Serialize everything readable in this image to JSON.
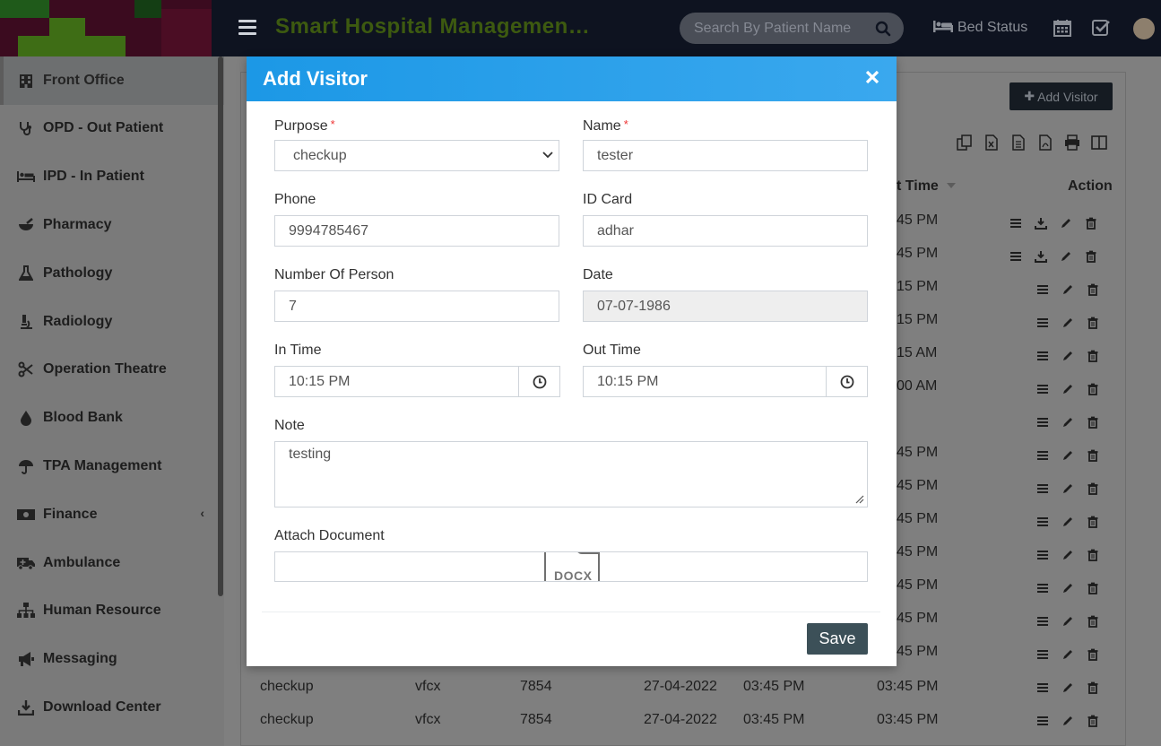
{
  "app": {
    "title": "Smart Hospital Managemen…",
    "search_placeholder": "Search By Patient Name",
    "bed_status": "Bed Status",
    "header_bg": "#0e1320",
    "title_color": "#3d5a10"
  },
  "sidebar": {
    "items": [
      {
        "label": "Front Office",
        "icon": "building-icon"
      },
      {
        "label": "OPD - Out Patient",
        "icon": "stethoscope-icon"
      },
      {
        "label": "IPD - In Patient",
        "icon": "bed-icon"
      },
      {
        "label": "Pharmacy",
        "icon": "mortar-pestle-icon"
      },
      {
        "label": "Pathology",
        "icon": "flask-icon"
      },
      {
        "label": "Radiology",
        "icon": "microscope-icon"
      },
      {
        "label": "Operation Theatre",
        "icon": "scissors-icon"
      },
      {
        "label": "Blood Bank",
        "icon": "tint-icon"
      },
      {
        "label": "TPA Management",
        "icon": "umbrella-icon"
      },
      {
        "label": "Finance",
        "icon": "money-icon"
      },
      {
        "label": "Ambulance",
        "icon": "ambulance-icon"
      },
      {
        "label": "Human Resource",
        "icon": "sitemap-icon"
      },
      {
        "label": "Messaging",
        "icon": "bullhorn-icon"
      },
      {
        "label": "Download Center",
        "icon": "download-icon"
      }
    ]
  },
  "background": {
    "add_visitor_label": "Add Visitor",
    "out_time_header": "t Time",
    "action_header": "Action",
    "out_times": [
      "45 PM",
      "45 PM",
      "15 PM",
      "15 PM",
      "15 AM",
      "00 AM",
      "",
      "45 PM",
      "45 PM",
      "45 PM",
      "45 PM",
      "45 PM",
      "45 PM",
      "45 PM"
    ],
    "bottom_rows": [
      {
        "purpose": "checkup",
        "name": "vfcx",
        "phone": "7854",
        "date": "27-04-2022",
        "in_time": "03:45 PM",
        "out_time": "03:45 PM"
      },
      {
        "purpose": "checkup",
        "name": "vfcx",
        "phone": "7854",
        "date": "27-04-2022",
        "in_time": "03:45 PM",
        "out_time": "03:45 PM"
      }
    ]
  },
  "modal": {
    "title": "Add Visitor",
    "header_color": "#1c98e6",
    "purpose": {
      "label": "Purpose",
      "value": "checkup"
    },
    "name": {
      "label": "Name",
      "value": "tester"
    },
    "phone": {
      "label": "Phone",
      "value": "9994785467"
    },
    "id_card": {
      "label": "ID Card",
      "value": "adhar"
    },
    "persons": {
      "label": "Number Of Person",
      "value": "7"
    },
    "date": {
      "label": "Date",
      "value": "07-07-1986"
    },
    "in_time": {
      "label": "In Time",
      "value": "10:15 PM"
    },
    "out_time": {
      "label": "Out Time",
      "value": "10:15 PM"
    },
    "note": {
      "label": "Note",
      "value": "testing"
    },
    "attach": {
      "label": "Attach Document",
      "file_type": "DOCX"
    },
    "save_label": "Save",
    "save_color": "#3c5058"
  }
}
